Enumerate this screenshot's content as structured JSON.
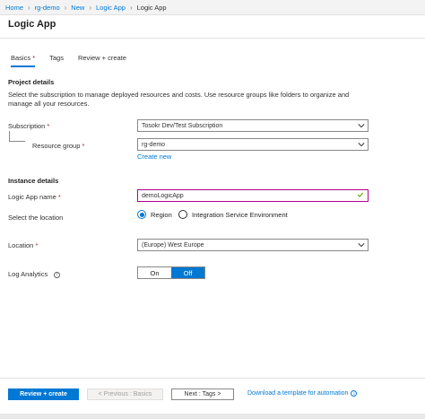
{
  "breadcrumb": [
    "Home",
    "rg-demo",
    "New",
    "Logic App",
    "Logic App"
  ],
  "page_title": "Logic App",
  "tabs": [
    {
      "label": "Basics",
      "required": "*"
    },
    {
      "label": "Tags"
    },
    {
      "label": "Review + create"
    }
  ],
  "project": {
    "heading": "Project details",
    "description": "Select the subscription to manage deployed resources and costs. Use resource groups like folders to organize and manage all your resources.",
    "subscription_label": "Subscription",
    "subscription_value": "Tosokr Dev/Test Subscription",
    "resource_group_label": "Resource group",
    "resource_group_value": "rg-demo",
    "create_new": "Create new",
    "required_mark": "*"
  },
  "instance": {
    "heading": "Instance details",
    "name_label": "Logic App name",
    "name_value": "demoLogicApp",
    "location_select_label": "Select the location",
    "radio_region": "Region",
    "radio_ise": "Integration Service Environment",
    "location_label": "Location",
    "location_value": "(Europe) West Europe",
    "log_analytics_label": "Log Analytics",
    "toggle_on": "On",
    "toggle_off": "Off",
    "required_mark": "*"
  },
  "footer": {
    "review_create": "Review + create",
    "previous": "< Previous : Basics",
    "next": "Next : Tags >",
    "download": "Download a template for automation"
  },
  "icons": {
    "info": "i",
    "separator": "›"
  },
  "colors": {
    "accent": "#0078d4",
    "required": "#a4262c",
    "valid_border": "#b4008c",
    "valid_check": "#57a300"
  }
}
